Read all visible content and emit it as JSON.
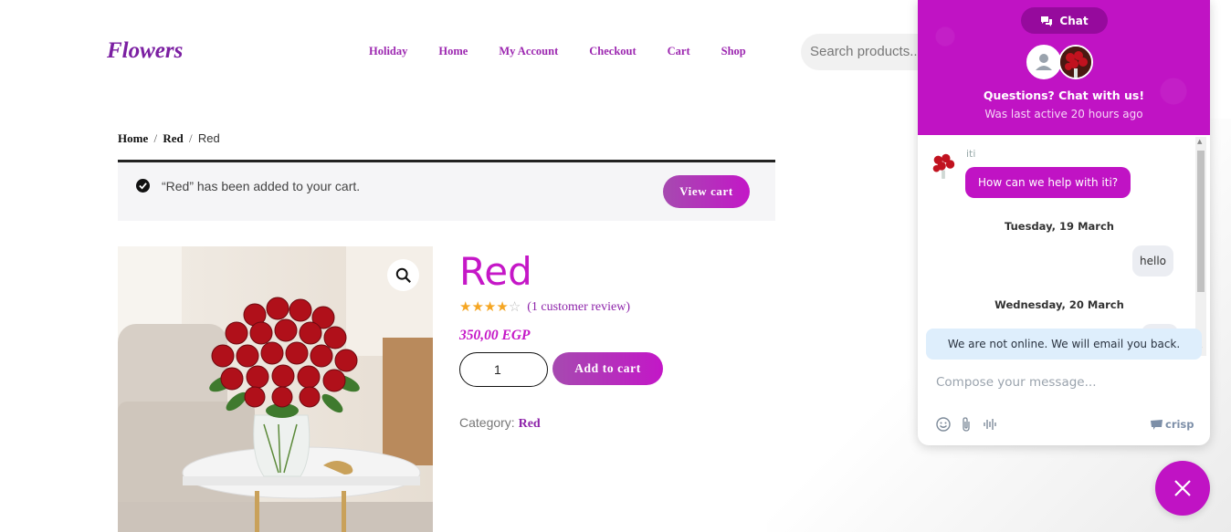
{
  "site": {
    "logo": "Flowers",
    "nav": [
      "Holiday",
      "Home",
      "My Account",
      "Checkout",
      "Cart",
      "Shop"
    ],
    "search_placeholder": "Search products..."
  },
  "breadcrumb": {
    "home": "Home",
    "sep": "/",
    "category": "Red",
    "current": "Red"
  },
  "notice": {
    "message": "“Red” has been added to your cart.",
    "button": "View cart"
  },
  "product": {
    "title": "Red",
    "rating": 4,
    "rating_max": 5,
    "review_link": "(1 customer review)",
    "price": "350,00 EGP",
    "quantity": "1",
    "add_to_cart": "Add to cart",
    "category_label": "Category:",
    "category": "Red"
  },
  "chat": {
    "tab_label": "Chat",
    "title": "Questions? Chat with us!",
    "subtitle": "Was last active 20 hours ago",
    "operator_name": "iti",
    "messages": [
      {
        "text": "How can we help with iti?"
      },
      {
        "date": "Tuesday, 19 March"
      },
      {
        "text": "hello"
      },
      {
        "date": "Wednesday, 20 March"
      }
    ],
    "offline_notice": "We are not online. We will email you back.",
    "compose_placeholder": "Compose your message...",
    "brand": "crisp"
  },
  "colors": {
    "accent": "#c013c4",
    "nav_link": "#9c27b0",
    "star": "#f5a623"
  }
}
